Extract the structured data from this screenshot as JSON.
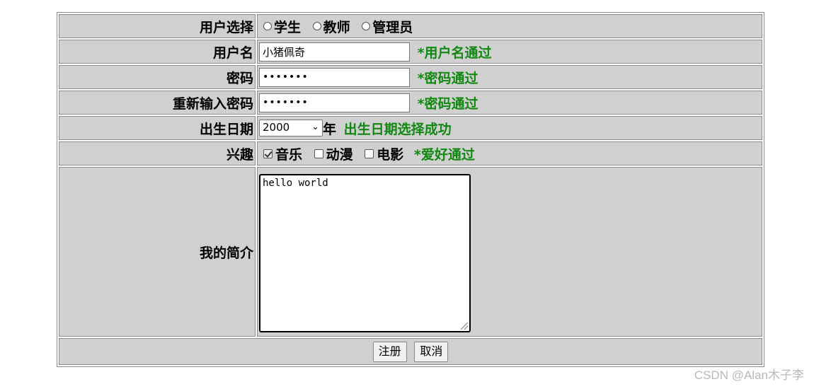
{
  "form": {
    "role": {
      "label": "用户选择",
      "options": [
        "学生",
        "教师",
        "管理员"
      ]
    },
    "username": {
      "label": "用户名",
      "value": "小猪佩奇",
      "hint": "*用户名通过"
    },
    "password": {
      "label": "密码",
      "value": "•••••••",
      "hint": "*密码通过"
    },
    "confirm_password": {
      "label": "重新输入密码",
      "value": "•••••••",
      "hint": "*密码通过"
    },
    "birth": {
      "label": "出生日期",
      "year_value": "2000",
      "year_suffix": "年",
      "hint": "出生日期选择成功"
    },
    "hobbies": {
      "label": "兴趣",
      "options": [
        {
          "label": "音乐",
          "checked": true
        },
        {
          "label": "动漫",
          "checked": false
        },
        {
          "label": "电影",
          "checked": false
        }
      ],
      "hint": "*爱好通过"
    },
    "bio": {
      "label": "我的简介",
      "value": "hello world"
    },
    "buttons": {
      "register": "注册",
      "cancel": "取消"
    }
  },
  "watermark": "CSDN @Alan木子李",
  "colors": {
    "cell_bg": "#d0d0d0",
    "hint_green": "#118811"
  }
}
